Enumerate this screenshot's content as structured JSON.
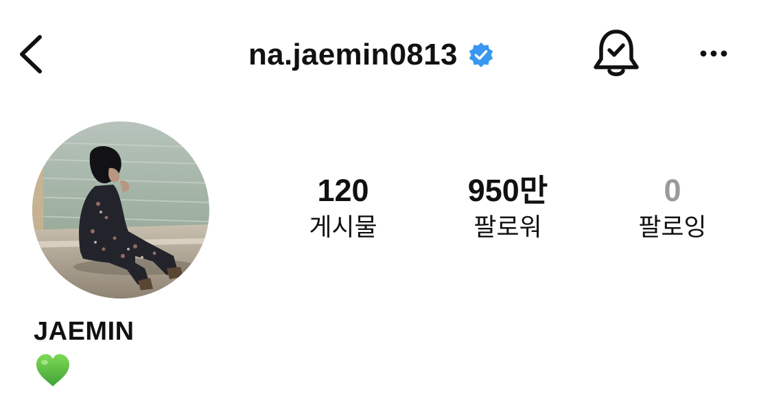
{
  "header": {
    "username": "na.jaemin0813",
    "verified": true,
    "accent_color": "#3897f0"
  },
  "icons": {
    "back": "chevron-left-icon",
    "verified": "verified-badge-icon",
    "notifications": "bell-check-icon",
    "more": "more-horizontal-icon",
    "bio": "green-heart-icon"
  },
  "profile": {
    "display_name": "JAEMIN",
    "bio_emoji": "💚"
  },
  "stats": {
    "posts": {
      "value": "120",
      "label": "게시물"
    },
    "followers": {
      "value": "950만",
      "label": "팔로워"
    },
    "following": {
      "value": "0",
      "label": "팔로잉"
    }
  }
}
